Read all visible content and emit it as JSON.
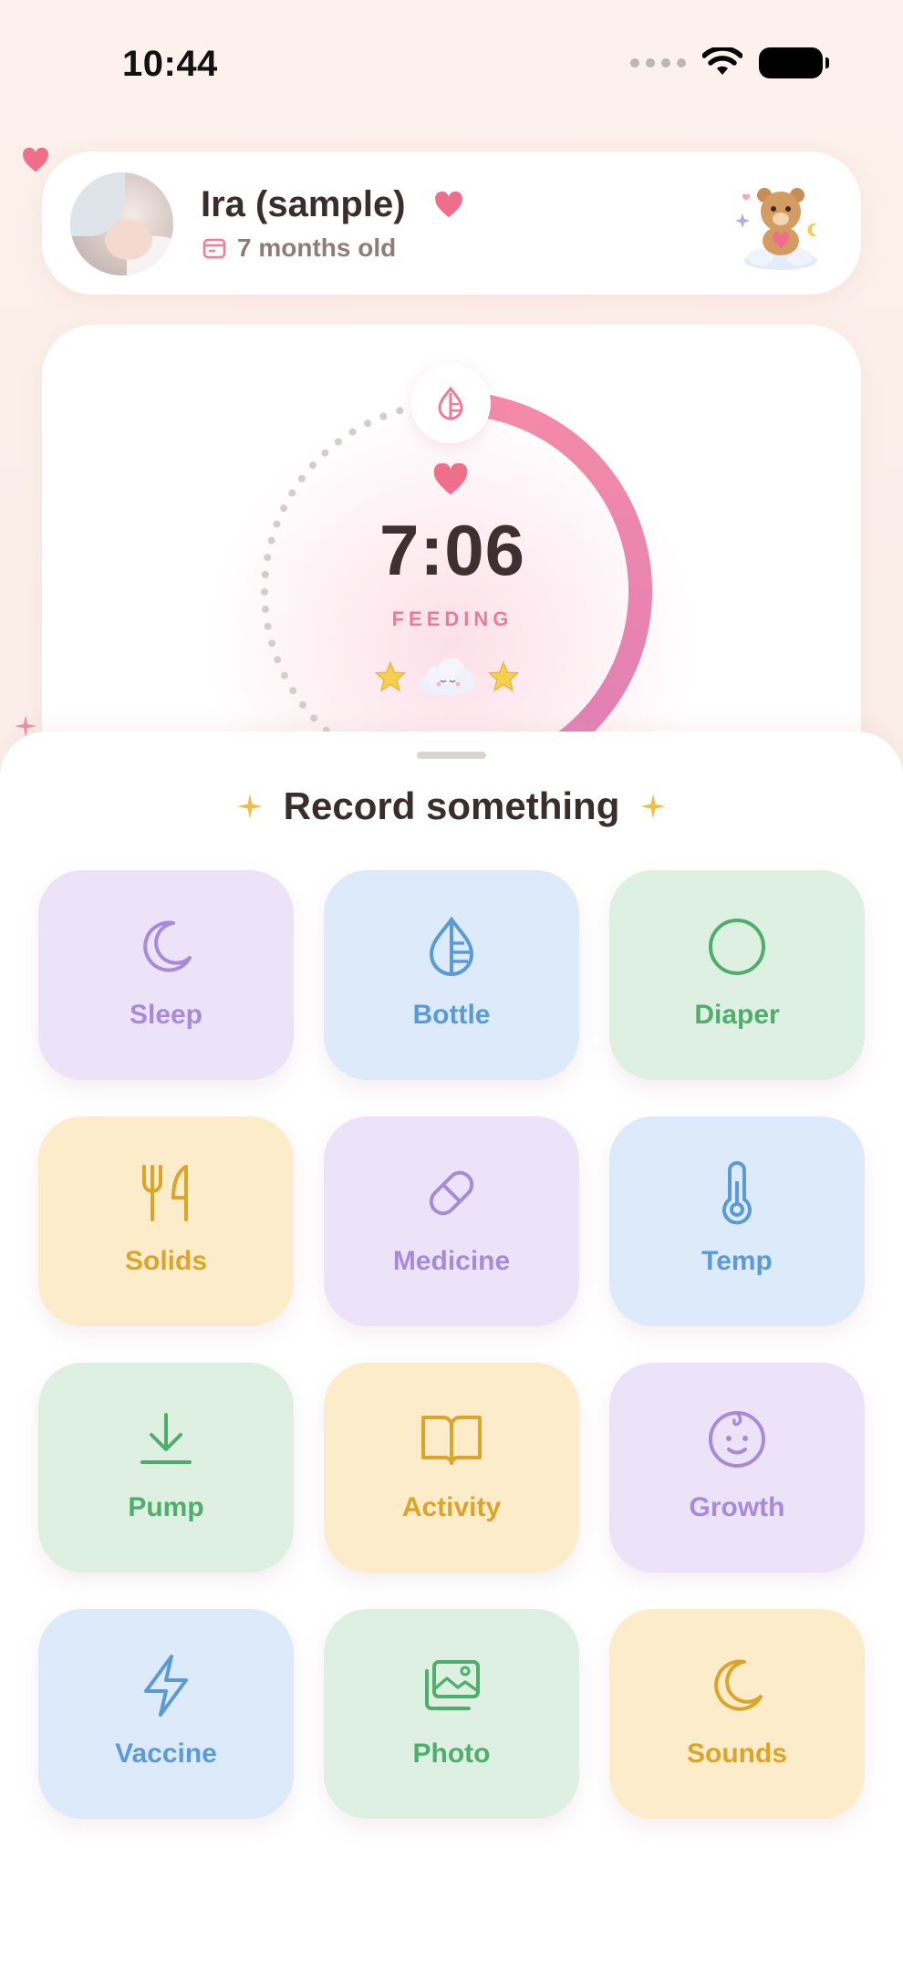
{
  "status_bar": {
    "time": "10:44"
  },
  "profile": {
    "name": "Ira (sample)",
    "age": "7 months old"
  },
  "timer": {
    "time": "7:06",
    "label": "FEEDING",
    "progress_fraction": 0.55
  },
  "sheet": {
    "title": "Record something",
    "tiles": [
      {
        "label": "Sleep",
        "icon": "moon-icon",
        "color": "purple"
      },
      {
        "label": "Bottle",
        "icon": "drop-icon",
        "color": "blue"
      },
      {
        "label": "Diaper",
        "icon": "circle-icon",
        "color": "green"
      },
      {
        "label": "Solids",
        "icon": "fork-knife-icon",
        "color": "yellow"
      },
      {
        "label": "Medicine",
        "icon": "pill-icon",
        "color": "purple"
      },
      {
        "label": "Temp",
        "icon": "thermometer-icon",
        "color": "blue"
      },
      {
        "label": "Pump",
        "icon": "download-icon",
        "color": "green"
      },
      {
        "label": "Activity",
        "icon": "book-icon",
        "color": "yellow"
      },
      {
        "label": "Growth",
        "icon": "baby-face-icon",
        "color": "purple"
      },
      {
        "label": "Vaccine",
        "icon": "lightning-icon",
        "color": "blue"
      },
      {
        "label": "Photo",
        "icon": "photo-icon",
        "color": "green"
      },
      {
        "label": "Sounds",
        "icon": "moon-icon",
        "color": "yellow"
      }
    ]
  },
  "colors": {
    "accent_pink": "#ec7b98",
    "text_dark": "#3a2d2d",
    "purple": "#a98ad8",
    "blue": "#5b9bd5",
    "green": "#4fae6c",
    "yellow": "#dba52a"
  }
}
